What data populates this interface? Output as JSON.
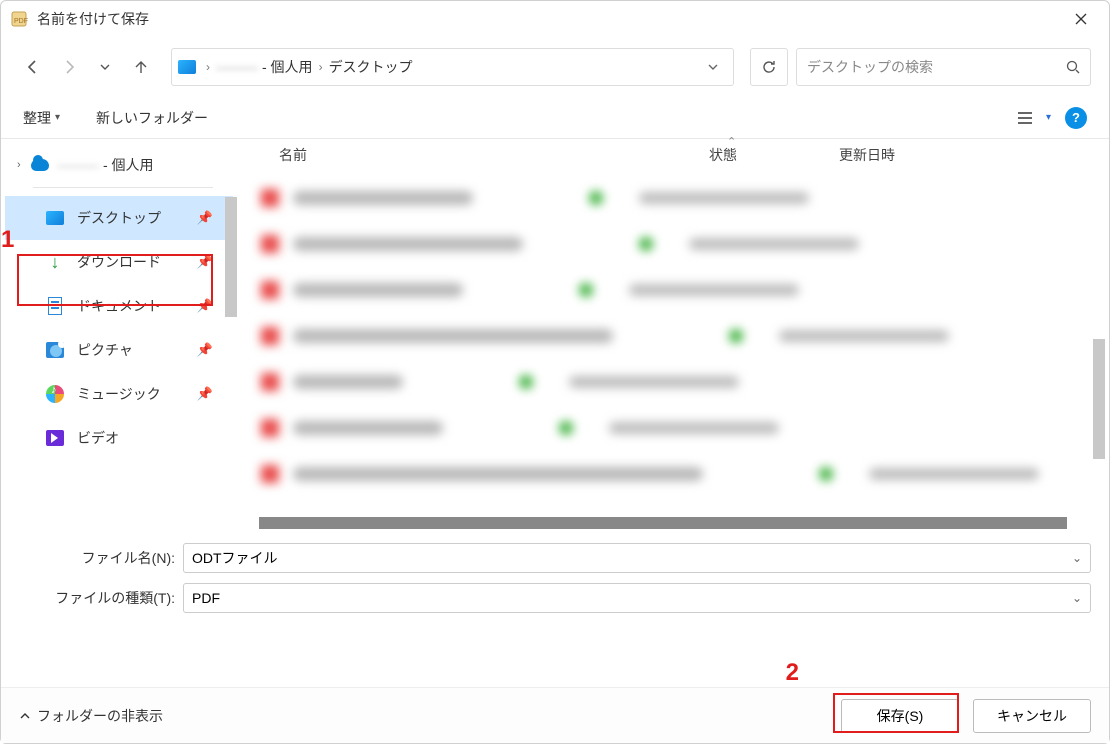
{
  "title": "名前を付けて保存",
  "breadcrumb": {
    "mid_blur": "———",
    "mid_suffix": " - 個人用",
    "leaf": "デスクトップ"
  },
  "search": {
    "placeholder": "デスクトップの検索"
  },
  "toolbar": {
    "organize": "整理",
    "new_folder": "新しいフォルダー"
  },
  "tree": {
    "onedrive_suffix": " - 個人用",
    "desktop": "デスクトップ",
    "downloads": "ダウンロード",
    "documents": "ドキュメント",
    "pictures": "ピクチャ",
    "music": "ミュージック",
    "videos": "ビデオ"
  },
  "columns": {
    "name": "名前",
    "state": "状態",
    "date": "更新日時"
  },
  "filename_label": "ファイル名(N):",
  "filename_value": "ODTファイル",
  "filetype_label": "ファイルの種類(T):",
  "filetype_value": "PDF",
  "hide_folders": "フォルダーの非表示",
  "save_btn": "保存(S)",
  "cancel_btn": "キャンセル",
  "annotations": {
    "one": "1",
    "two": "2"
  }
}
